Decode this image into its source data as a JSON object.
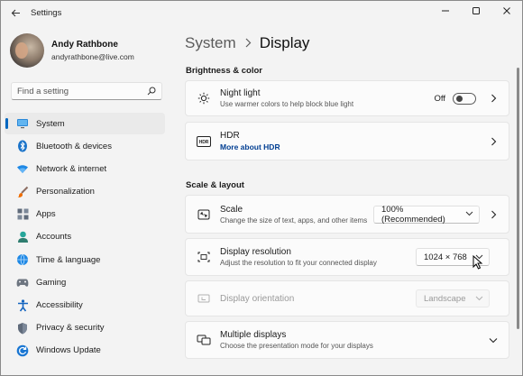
{
  "window": {
    "title": "Settings"
  },
  "profile": {
    "name": "Andy Rathbone",
    "email": "andyrathbone@live.com"
  },
  "search": {
    "placeholder": "Find a setting"
  },
  "nav": [
    {
      "label": "System",
      "icon": "monitor-icon",
      "active": true
    },
    {
      "label": "Bluetooth & devices",
      "icon": "bluetooth-icon"
    },
    {
      "label": "Network & internet",
      "icon": "wifi-icon"
    },
    {
      "label": "Personalization",
      "icon": "brush-icon"
    },
    {
      "label": "Apps",
      "icon": "apps-icon"
    },
    {
      "label": "Accounts",
      "icon": "person-icon"
    },
    {
      "label": "Time & language",
      "icon": "globe-clock-icon"
    },
    {
      "label": "Gaming",
      "icon": "controller-icon"
    },
    {
      "label": "Accessibility",
      "icon": "accessibility-icon"
    },
    {
      "label": "Privacy & security",
      "icon": "shield-icon"
    },
    {
      "label": "Windows Update",
      "icon": "update-icon"
    }
  ],
  "main": {
    "breadcrumb_parent": "System",
    "breadcrumb_current": "Display",
    "section_brightness": "Brightness & color",
    "section_scale": "Scale & layout",
    "night_light": {
      "title": "Night light",
      "sub": "Use warmer colors to help block blue light",
      "state": "Off"
    },
    "hdr": {
      "title": "HDR",
      "link": "More about HDR"
    },
    "scale": {
      "title": "Scale",
      "sub": "Change the size of text, apps, and other items",
      "value": "100% (Recommended)"
    },
    "resolution": {
      "title": "Display resolution",
      "sub": "Adjust the resolution to fit your connected display",
      "value": "1024 × 768"
    },
    "orientation": {
      "title": "Display orientation",
      "value": "Landscape"
    },
    "multiple": {
      "title": "Multiple displays",
      "sub": "Choose the presentation mode for your displays"
    }
  },
  "colors": {
    "accent": "#0067c0",
    "link": "#003e92"
  }
}
